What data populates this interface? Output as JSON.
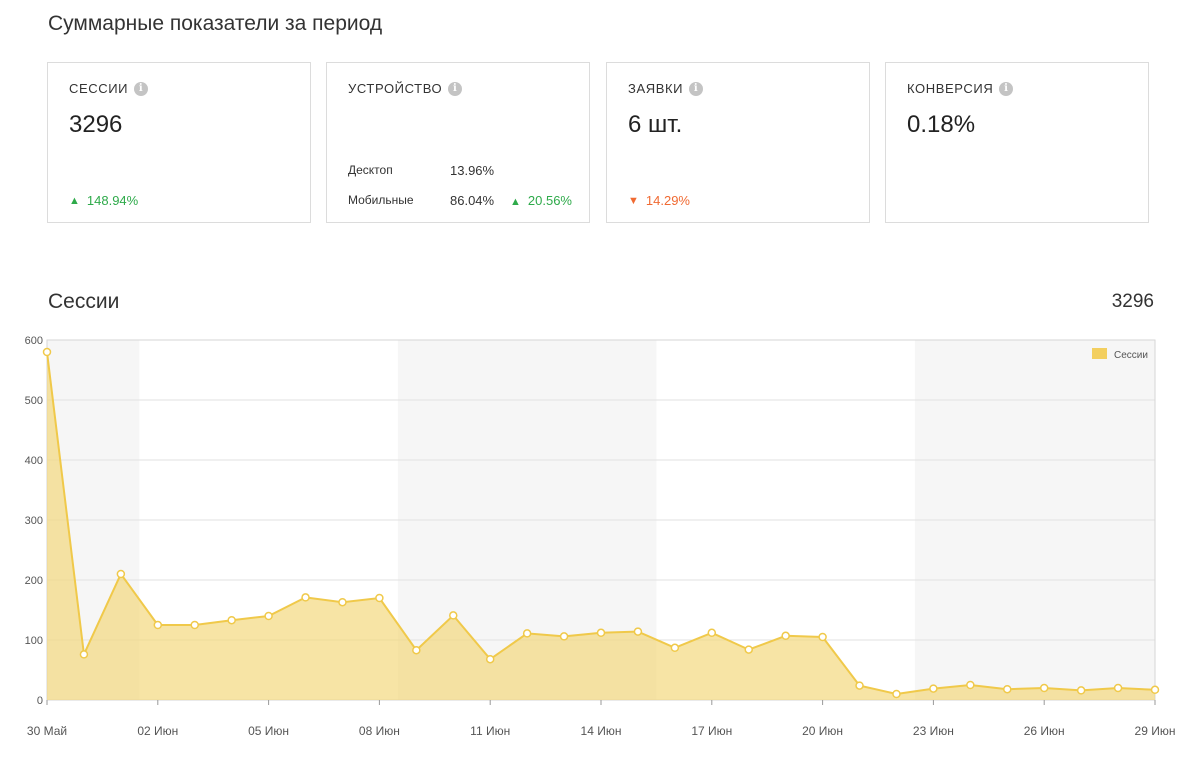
{
  "summary": {
    "title": "Суммарные показатели за период",
    "cards": {
      "sessions": {
        "label": "СЕССИИ",
        "value": "3296",
        "delta": "148.94%",
        "delta_direction": "up"
      },
      "device": {
        "label": "УСТРОЙСТВО",
        "rows": [
          {
            "name": "Десктоп",
            "value": "13.96%",
            "delta": ""
          },
          {
            "name": "Мобильные",
            "value": "86.04%",
            "delta": "20.56%"
          }
        ]
      },
      "leads": {
        "label": "ЗАЯВКИ",
        "value": "6 шт.",
        "delta": "14.29%",
        "delta_direction": "down"
      },
      "conversion": {
        "label": "КОНВЕРСИЯ",
        "value": "0.18%"
      }
    }
  },
  "sessions_chart": {
    "title": "Сессии",
    "total": "3296"
  },
  "colors": {
    "accent_fill": "#f3d97f",
    "accent_line": "#f0c94a",
    "up": "#2eaa4a",
    "down": "#f06a32"
  },
  "icons": {
    "info": "info-icon",
    "up": "triangle-up-icon",
    "down": "triangle-down-icon"
  },
  "chart_data": {
    "type": "area",
    "legend": [
      "Сессии"
    ],
    "legend_position": "top-right",
    "grid": true,
    "ylim": [
      0,
      600
    ],
    "yticks": [
      0,
      100,
      200,
      300,
      400,
      500,
      600
    ],
    "xtick_labels": [
      "30 Май",
      "02 Июн",
      "05 Июн",
      "08 Июн",
      "11 Июн",
      "14 Июн",
      "17 Июн",
      "20 Июн",
      "23 Июн",
      "26 Июн",
      "29 Июн"
    ],
    "x": [
      "30 Май",
      "31 Май",
      "01 Июн",
      "02 Июн",
      "03 Июн",
      "04 Июн",
      "05 Июн",
      "06 Июн",
      "07 Июн",
      "08 Июн",
      "09 Июн",
      "10 Июн",
      "11 Июн",
      "12 Июн",
      "13 Июн",
      "14 Июн",
      "15 Июн",
      "16 Июн",
      "17 Июн",
      "18 Июн",
      "19 Июн",
      "20 Июн",
      "21 Июн",
      "22 Июн",
      "23 Июн",
      "24 Июн",
      "25 Июн",
      "26 Июн",
      "27 Июн",
      "28 Июн",
      "29 Июн"
    ],
    "series": [
      {
        "name": "Сессии",
        "values": [
          580,
          76,
          210,
          125,
          125,
          133,
          140,
          171,
          163,
          170,
          83,
          141,
          68,
          111,
          106,
          112,
          114,
          87,
          112,
          84,
          107,
          105,
          24,
          10,
          19,
          25,
          18,
          20,
          16,
          20,
          17
        ]
      }
    ]
  }
}
